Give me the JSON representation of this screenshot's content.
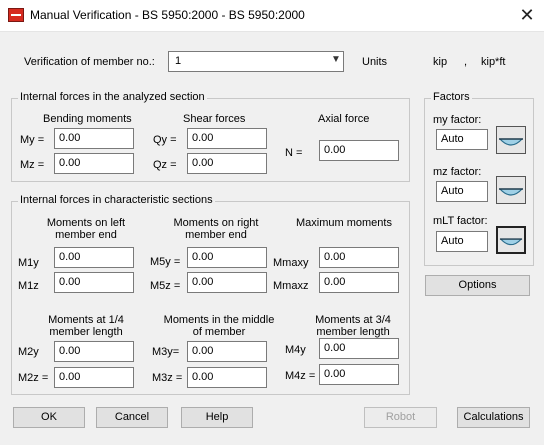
{
  "window": {
    "title": "Manual Verification - BS 5950:2000 - BS 5950:2000",
    "close_glyph": "✕"
  },
  "member": {
    "label": "Verification of member no.:",
    "value": "1",
    "units_label": "Units",
    "unit_force": "kip",
    "unit_sep": ",",
    "unit_moment": "kip*ft"
  },
  "analyzed": {
    "title": "Internal forces in the analyzed section",
    "bending_title": "Bending moments",
    "shear_title": "Shear forces",
    "axial_title": "Axial force",
    "my_label": "My =",
    "my_value": "0.00",
    "mz_label": "Mz =",
    "mz_value": "0.00",
    "qy_label": "Qy =",
    "qy_value": "0.00",
    "qz_label": "Qz =",
    "qz_value": "0.00",
    "n_label": "N =",
    "n_value": "0.00"
  },
  "characteristic": {
    "title": "Internal forces in characteristic sections",
    "left_title_1": "Moments on left",
    "left_title_2": "member end",
    "right_title_1": "Moments on right",
    "right_title_2": "member end",
    "max_title": "Maximum moments",
    "m1y_label": "M1y",
    "m1y_value": "0.00",
    "m1z_label": "M1z",
    "m1z_value": "0.00",
    "m5y_label": "M5y =",
    "m5y_value": "0.00",
    "m5z_label": "M5z =",
    "m5z_value": "0.00",
    "mmaxy_label": "Mmaxy",
    "mmaxy_value": "0.00",
    "mmaxz_label": "Mmaxz",
    "mmaxz_value": "0.00",
    "quarter_title_1": "Moments at 1/4",
    "quarter_title_2": "member length",
    "middle_title_1": "Moments in the middle",
    "middle_title_2": "of member",
    "threeq_title_1": "Moments at 3/4",
    "threeq_title_2": "member length",
    "m2y_label": "M2y",
    "m2y_value": "0.00",
    "m2z_label": "M2z =",
    "m2z_value": "0.00",
    "m3y_label": "M3y=",
    "m3y_value": "0.00",
    "m3z_label": "M3z =",
    "m3z_value": "0.00",
    "m4y_label": "M4y",
    "m4y_value": "0.00",
    "m4z_label": "M4z =",
    "m4z_value": "0.00"
  },
  "factors": {
    "title": "Factors",
    "my_label": "my factor:",
    "my_value": "Auto",
    "mz_label": "mz factor:",
    "mz_value": "Auto",
    "mlt_label": "mLT factor:",
    "mlt_value": "Auto",
    "icon": "moment-diagram-icon"
  },
  "buttons": {
    "options": "Options",
    "ok": "OK",
    "cancel": "Cancel",
    "help": "Help",
    "robot": "Robot",
    "calculations": "Calculations"
  }
}
